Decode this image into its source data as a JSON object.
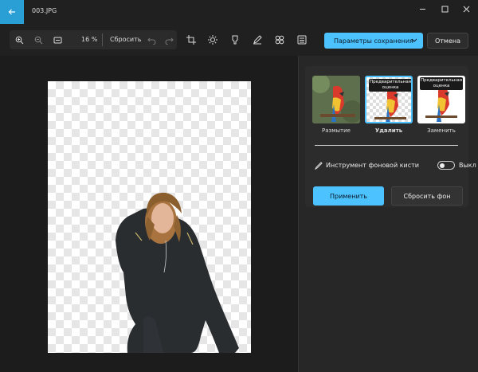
{
  "window": {
    "title": "003.JPG"
  },
  "toolbar": {
    "zoom_percent": "16 %",
    "reset_label": "Сбросить",
    "icons": [
      "zoom-in-icon",
      "zoom-out-icon",
      "fit-icon",
      "undo-icon",
      "redo-icon",
      "crop-icon",
      "brightness-icon",
      "markup-icon",
      "pen-icon",
      "filter-icon",
      "background-icon"
    ]
  },
  "actions": {
    "save_label": "Параметры сохранения",
    "cancel_label": "Отмена",
    "accent": "#4cc2ff"
  },
  "panel": {
    "options": [
      {
        "label": "Размытие",
        "badge": ""
      },
      {
        "label": "Удалить",
        "badge": "Предварительная оценка",
        "selected": true
      },
      {
        "label": "Заменить",
        "badge": "Предварительная оценка"
      }
    ],
    "brush_label": "Инструмент фоновой кисти",
    "toggle_state": "Выкл",
    "apply_label": "Применить",
    "reset_bg_label": "Сбросить фон"
  }
}
